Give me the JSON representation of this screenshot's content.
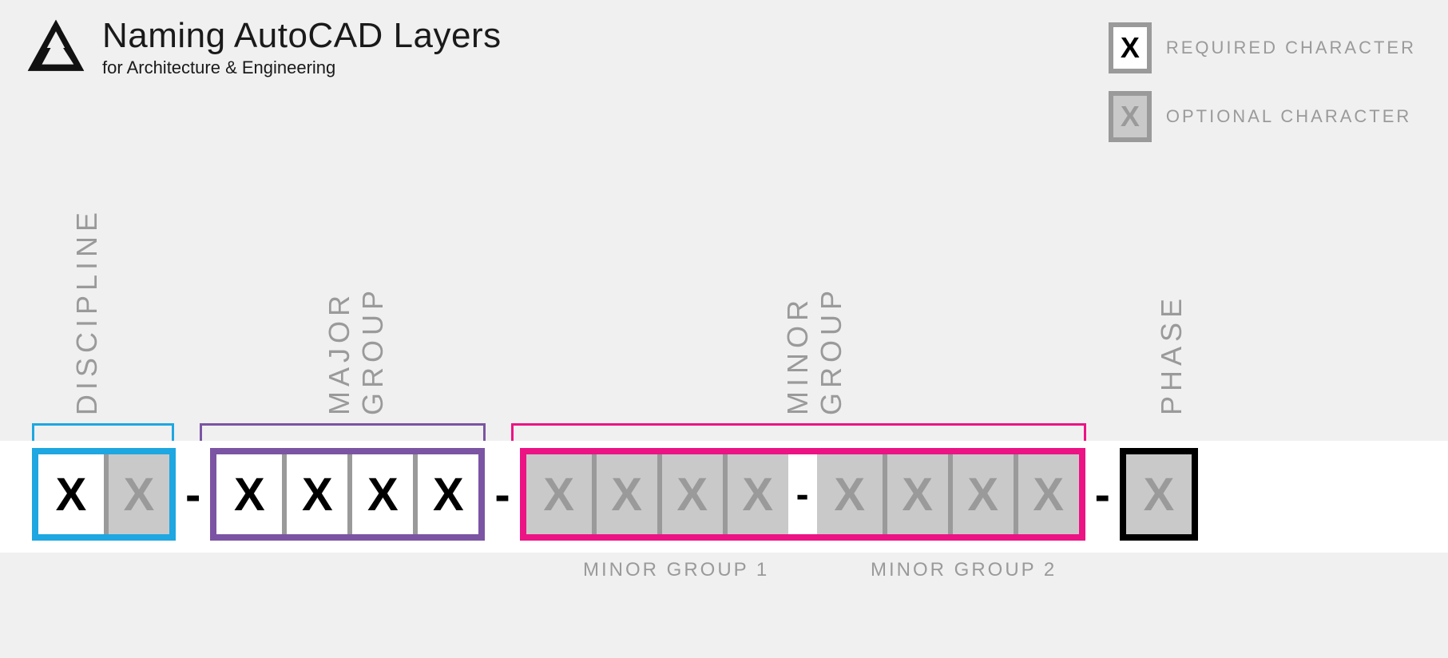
{
  "header": {
    "title": "Naming AutoCAD Layers",
    "subtitle": "for Architecture & Engineering"
  },
  "legend": {
    "required": {
      "glyph": "X",
      "label": "REQUIRED CHARACTER"
    },
    "optional": {
      "glyph": "X",
      "label": "OPTIONAL CHARACTER"
    }
  },
  "sections": {
    "discipline": "DISCIPLINE",
    "major": "MAJOR GROUP",
    "minor": "MINOR GROUP",
    "phase": "PHASE"
  },
  "colors": {
    "discipline": "#1ea7e1",
    "major": "#7b54a3",
    "minor": "#ec1384",
    "phase": "#000000"
  },
  "cell_glyph": "X",
  "separator": "-",
  "sublabels": {
    "minor1": "MINOR GROUP 1",
    "minor2": "MINOR GROUP 2"
  }
}
